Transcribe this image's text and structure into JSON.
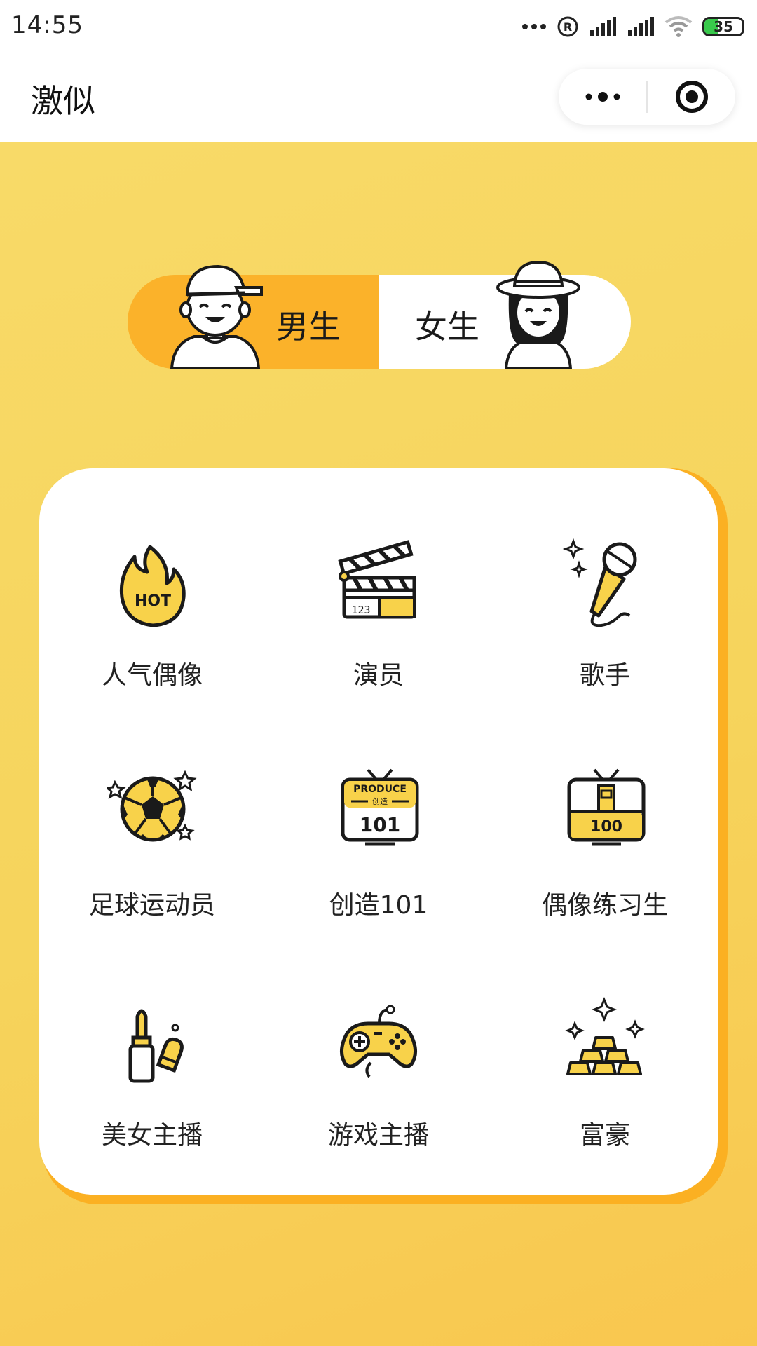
{
  "status_bar": {
    "time": "14:55",
    "battery": "35",
    "icons": [
      "more-dots-icon",
      "registered-icon",
      "signal-icon",
      "signal-icon",
      "wifi-icon",
      "battery-icon"
    ]
  },
  "title_bar": {
    "title": "激似",
    "more_icon": "more-dots-icon",
    "close_icon": "target-circle-icon"
  },
  "gender_toggle": {
    "male_label": "男生",
    "female_label": "女生",
    "selected": "male",
    "active_color": "#fbb22a"
  },
  "categories": [
    {
      "label": "人气偶像",
      "icon": "hot-flame-icon"
    },
    {
      "label": "演员",
      "icon": "clapperboard-icon"
    },
    {
      "label": "歌手",
      "icon": "microphone-icon"
    },
    {
      "label": "足球运动员",
      "icon": "soccer-ball-icon"
    },
    {
      "label": "创造101",
      "icon": "produce-101-tv-icon",
      "icon_text": [
        "PRODUCE",
        "创造",
        "101"
      ]
    },
    {
      "label": "偶像练习生",
      "icon": "idol-trainee-tv-icon",
      "icon_text": [
        "100"
      ]
    },
    {
      "label": "美女主播",
      "icon": "lipstick-nail-icon"
    },
    {
      "label": "游戏主播",
      "icon": "gamepad-icon"
    },
    {
      "label": "富豪",
      "icon": "gold-bars-icon"
    }
  ],
  "colors": {
    "background": "#f7d460",
    "accent": "#fbb22a",
    "icon_fill": "#f8d24a",
    "stroke": "#1a1a1a"
  }
}
